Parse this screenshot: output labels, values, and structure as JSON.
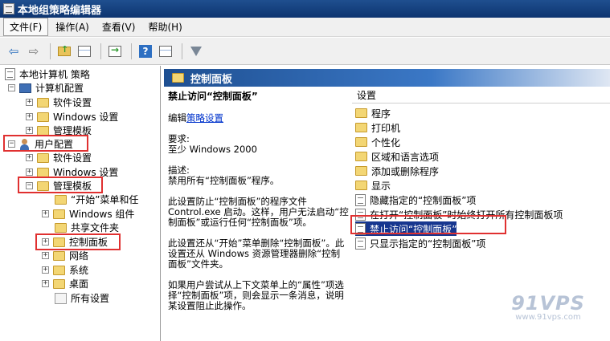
{
  "window": {
    "title": "本地组策略编辑器"
  },
  "menu": [
    "文件(F)",
    "操作(A)",
    "查看(V)",
    "帮助(H)"
  ],
  "toolbar": {
    "icons": [
      "back-arrow-icon",
      "forward-arrow-icon",
      "up-folder-icon",
      "show-hide-tree-icon",
      "export-list-icon",
      "help-icon",
      "properties-icon",
      "filter-icon"
    ]
  },
  "tree": {
    "root": "本地计算机 策略",
    "computer_config": "计算机配置",
    "cc_software": "软件设置",
    "cc_windows": "Windows 设置",
    "cc_admin": "管理模板",
    "user_config": "用户配置",
    "uc_software": "软件设置",
    "uc_windows": "Windows 设置",
    "uc_admin": "管理模板",
    "start_menu": "“开始”菜单和任",
    "windows_components": "Windows 组件",
    "shared_folders": "共享文件夹",
    "control_panel": "控制面板",
    "network": "网络",
    "system": "系统",
    "desktop": "桌面",
    "all_settings": "所有设置"
  },
  "content": {
    "header": "控制面板",
    "policy_title": "禁止访问“控制面板”",
    "edit_prefix": "编辑",
    "edit_link": "策略设置",
    "requirements_label": "要求:",
    "requirements_value": "至少 Windows 2000",
    "description_label": "描述:",
    "description_text": "禁用所有“控制面板”程序。",
    "para1": "此设置防止“控制面板”的程序文件 Control.exe 启动。这样，用户无法启动“控制面板”或运行任何“控制面板”项。",
    "para2": "此设置还从“开始”菜单删除“控制面板”。此设置还从 Windows 资源管理器删除“控制面板”文件夹。",
    "para3": "如果用户尝试从上下文菜单上的“属性”项选择“控制面板”项，则会显示一条消息，说明某设置阻止此操作。"
  },
  "settings": {
    "column_header": "设置",
    "rows": [
      {
        "label": "程序",
        "type": "folder"
      },
      {
        "label": "打印机",
        "type": "folder"
      },
      {
        "label": "个性化",
        "type": "folder"
      },
      {
        "label": "区域和语言选项",
        "type": "folder"
      },
      {
        "label": "添加或删除程序",
        "type": "folder"
      },
      {
        "label": "显示",
        "type": "folder"
      },
      {
        "label": "隐藏指定的“控制面板”项",
        "type": "policy"
      },
      {
        "label": "在打开“控制面板”时始终打开所有控制面板项",
        "type": "policy"
      },
      {
        "label": "禁止访问“控制面板”",
        "type": "policy",
        "selected": true
      },
      {
        "label": "只显示指定的“控制面板”项",
        "type": "policy"
      }
    ]
  },
  "watermark": {
    "big": "91VPS",
    "small": "www.91vps.com"
  },
  "colors": {
    "title_bar": "#0d3470",
    "header_gradient_start": "#1e4f91",
    "selection": "#16368f",
    "highlight_box": "#e03030"
  }
}
